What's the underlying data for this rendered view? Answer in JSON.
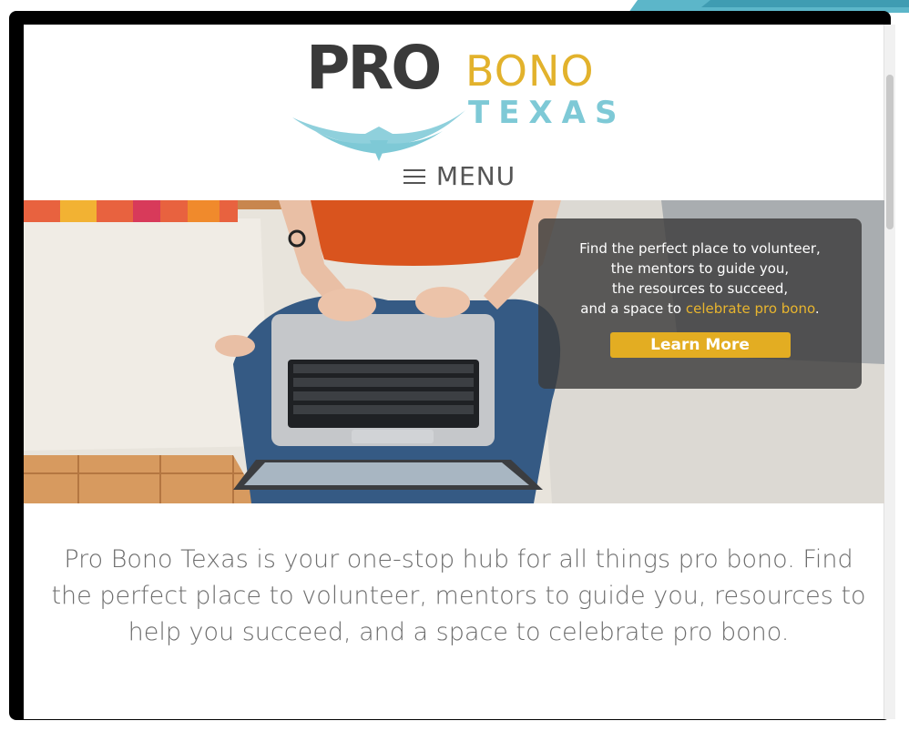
{
  "logo": {
    "pro": "PRO",
    "bono": "BONO",
    "texas": "TEXAS"
  },
  "nav": {
    "menu_label": "MENU",
    "menu_icon": "hamburger-icon"
  },
  "hero": {
    "lines": [
      "Find the perfect place to volunteer,",
      "the mentors to guide you,",
      "the resources to succeed,"
    ],
    "last_line_prefix": "and a space to ",
    "last_line_highlight": "celebrate pro bono",
    "last_line_suffix": ".",
    "cta_label": "Learn More"
  },
  "description": "Pro Bono Texas is your one-stop hub for all things pro bono. Find the perfect place to volunteer, mentors to guide you, resources to help you succeed, and a space to celebrate pro bono.",
  "colors": {
    "accent_gold": "#e3ad22",
    "accent_teal": "#7ec9d6",
    "dark_gray": "#3a3a3a"
  }
}
